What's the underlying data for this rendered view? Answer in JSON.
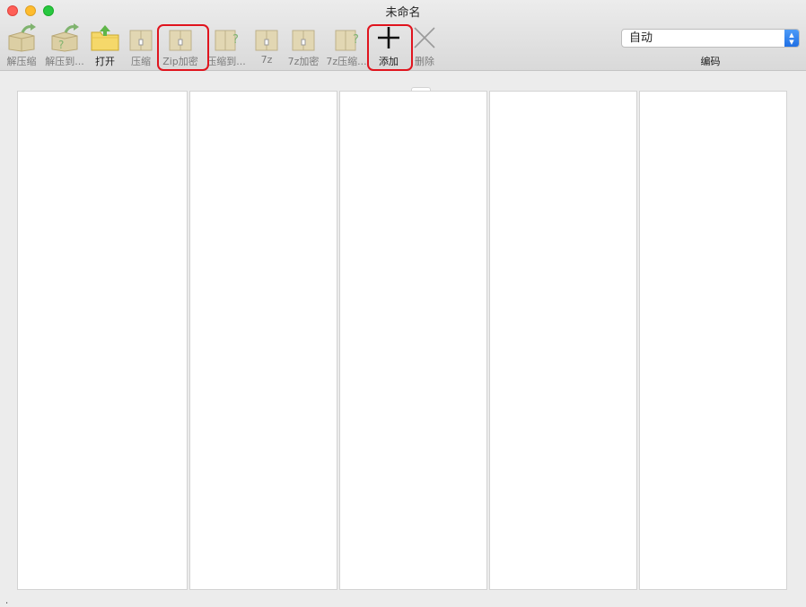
{
  "window": {
    "title": "未命名"
  },
  "toolbar": {
    "items": [
      {
        "label": "解压缩",
        "icon": "box-extract-icon"
      },
      {
        "label": "解压到...",
        "icon": "box-extract-to-icon"
      },
      {
        "label": "打开",
        "icon": "folder-open-icon"
      },
      {
        "label": "压缩",
        "icon": "archive-compress-icon"
      },
      {
        "label": "Zip加密",
        "icon": "archive-zip-encrypt-icon"
      },
      {
        "label": "压缩到...",
        "icon": "archive-compress-to-icon"
      },
      {
        "label": "7z",
        "icon": "archive-7z-icon"
      },
      {
        "label": "7z加密",
        "icon": "archive-7z-encrypt-icon"
      },
      {
        "label": "7z压缩...",
        "icon": "archive-7z-compress-icon"
      },
      {
        "label": "添加",
        "icon": "plus-icon"
      },
      {
        "label": "删除",
        "icon": "x-delete-icon"
      }
    ]
  },
  "encoding": {
    "value": "自动",
    "label": "编码"
  },
  "colors": {
    "highlight": "#e0141e",
    "select_accent": "#1f6fe5"
  }
}
